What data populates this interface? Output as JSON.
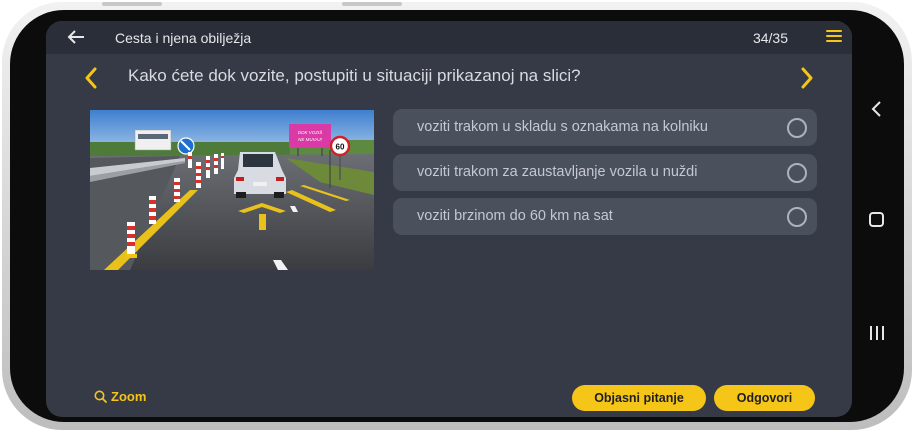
{
  "header": {
    "title": "Cesta i njena obilježja",
    "counter": "34/35"
  },
  "question": {
    "text": "Kako ćete dok vozite, postupiti u situaciji prikazanoj na slici?"
  },
  "image": {
    "billboard_text": "DOK VOZIŠ NE MUVAJ!",
    "speed_sign": "60"
  },
  "answers": [
    {
      "text": "voziti trakom u skladu s oznakama na kolniku",
      "selected": false
    },
    {
      "text": "voziti trakom za zaustavljanje vozila u nuždi",
      "selected": false
    },
    {
      "text": "voziti brzinom do 60 km na sat",
      "selected": false
    }
  ],
  "footer": {
    "zoom_label": "Zoom",
    "explain_label": "Objasni pitanje",
    "answer_label": "Odgovori"
  },
  "colors": {
    "accent": "#f5c518",
    "screen_bg": "#363a46",
    "header_bg": "#2a2e38",
    "answer_bg": "#4b505d"
  }
}
